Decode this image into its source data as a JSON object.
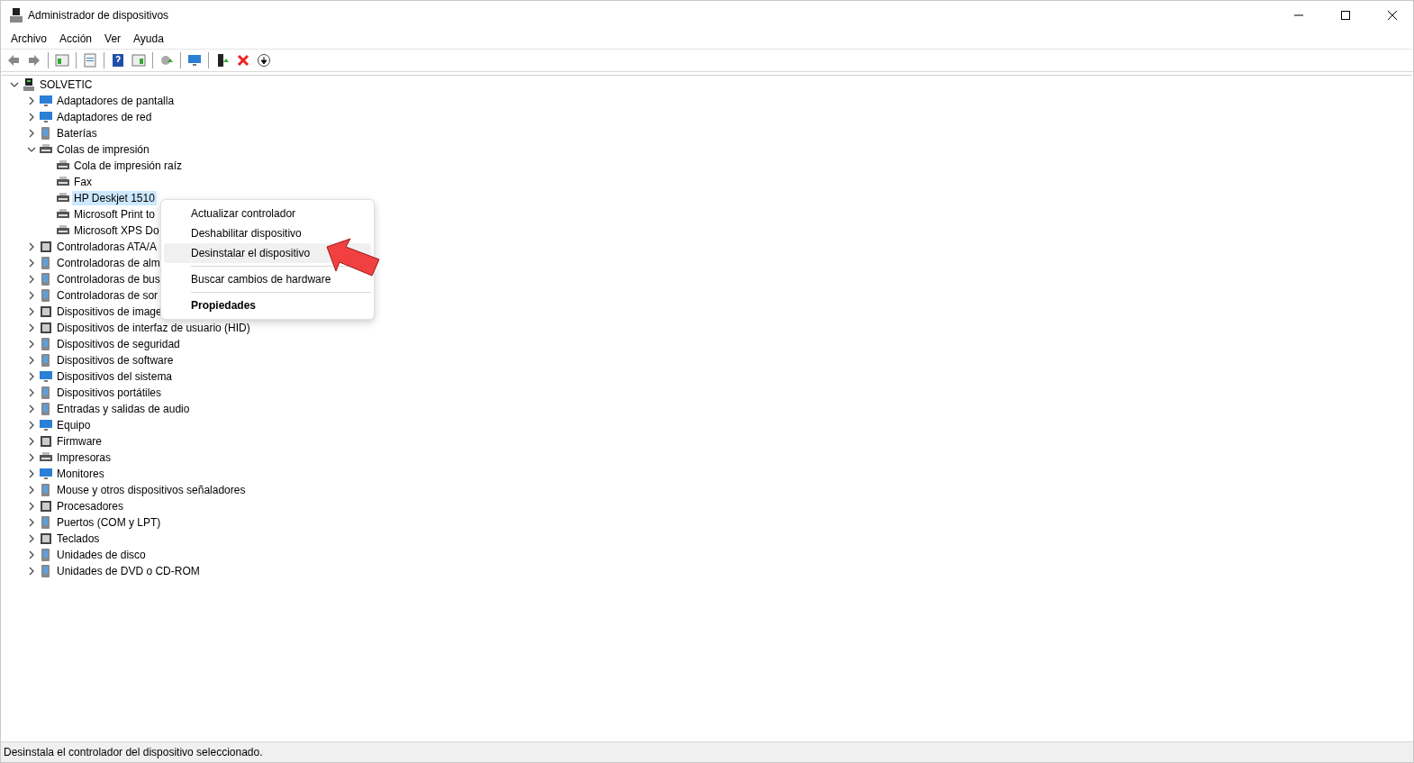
{
  "window": {
    "title": "Administrador de dispositivos"
  },
  "menu_bar": [
    "Archivo",
    "Acción",
    "Ver",
    "Ayuda"
  ],
  "tree": [
    {
      "label": "SOLVETIC",
      "expanded": true,
      "selected": false,
      "children": [
        {
          "label": "Adaptadores de pantalla",
          "expanded": false,
          "selected": false
        },
        {
          "label": "Adaptadores de red",
          "expanded": false,
          "selected": false
        },
        {
          "label": "Baterías",
          "expanded": false,
          "selected": false
        },
        {
          "label": "Colas de impresión",
          "expanded": true,
          "selected": false,
          "children": [
            {
              "label": "Cola de impresión raíz",
              "selected": false
            },
            {
              "label": "Fax",
              "selected": false
            },
            {
              "label": "HP Deskjet 1510",
              "selected": true
            },
            {
              "label": "Microsoft Print to",
              "selected": false
            },
            {
              "label": "Microsoft XPS Do",
              "selected": false
            }
          ]
        },
        {
          "label": "Controladoras ATA/A",
          "expanded": false,
          "selected": false
        },
        {
          "label": "Controladoras de alm",
          "expanded": false,
          "selected": false
        },
        {
          "label": "Controladoras de bus",
          "expanded": false,
          "selected": false
        },
        {
          "label": "Controladoras de sor",
          "expanded": false,
          "selected": false
        },
        {
          "label": "Dispositivos de image",
          "expanded": false,
          "selected": false
        },
        {
          "label": "Dispositivos de interfaz de usuario (HID)",
          "expanded": false,
          "selected": false
        },
        {
          "label": "Dispositivos de seguridad",
          "expanded": false,
          "selected": false
        },
        {
          "label": "Dispositivos de software",
          "expanded": false,
          "selected": false
        },
        {
          "label": "Dispositivos del sistema",
          "expanded": false,
          "selected": false
        },
        {
          "label": "Dispositivos portátiles",
          "expanded": false,
          "selected": false
        },
        {
          "label": "Entradas y salidas de audio",
          "expanded": false,
          "selected": false
        },
        {
          "label": "Equipo",
          "expanded": false,
          "selected": false
        },
        {
          "label": "Firmware",
          "expanded": false,
          "selected": false
        },
        {
          "label": "Impresoras",
          "expanded": false,
          "selected": false
        },
        {
          "label": "Monitores",
          "expanded": false,
          "selected": false
        },
        {
          "label": "Mouse y otros dispositivos señaladores",
          "expanded": false,
          "selected": false
        },
        {
          "label": "Procesadores",
          "expanded": false,
          "selected": false
        },
        {
          "label": "Puertos (COM y LPT)",
          "expanded": false,
          "selected": false
        },
        {
          "label": "Teclados",
          "expanded": false,
          "selected": false
        },
        {
          "label": "Unidades de disco",
          "expanded": false,
          "selected": false
        },
        {
          "label": "Unidades de DVD o CD-ROM",
          "expanded": false,
          "selected": false
        }
      ]
    }
  ],
  "context_menu": [
    {
      "kind": "item",
      "label": "Actualizar controlador",
      "selected": false
    },
    {
      "kind": "item",
      "label": "Deshabilitar dispositivo",
      "selected": false
    },
    {
      "kind": "item",
      "label": "Desinstalar el dispositivo",
      "selected": true
    },
    {
      "kind": "separator"
    },
    {
      "kind": "item",
      "label": "Buscar cambios de hardware",
      "selected": false
    },
    {
      "kind": "separator"
    },
    {
      "kind": "default",
      "label": "Propiedades",
      "selected": false
    }
  ],
  "status_bar": "Desinstala el controlador del dispositivo seleccionado."
}
